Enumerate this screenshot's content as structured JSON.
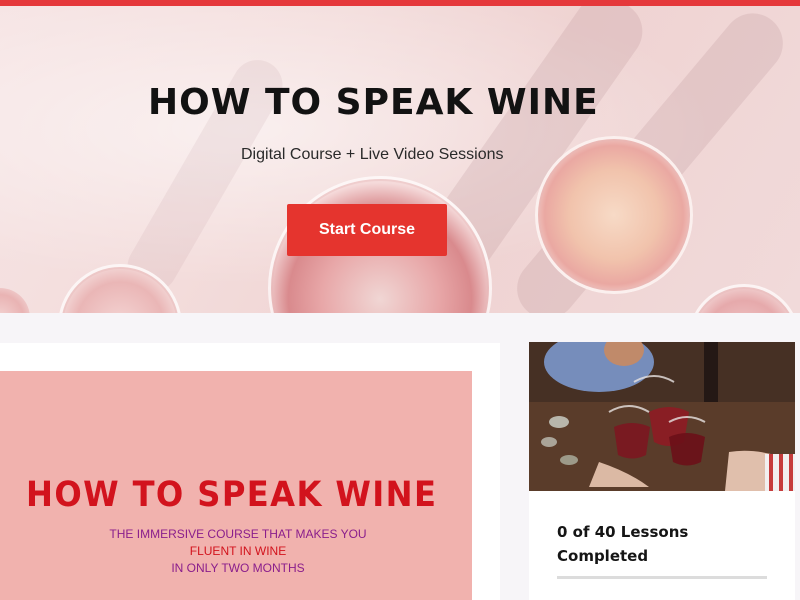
{
  "hero": {
    "title": "HOW TO SPEAK WINE",
    "subtitle": "Digital Course + Live Video Sessions",
    "cta_label": "Start Course"
  },
  "promo": {
    "title": "HOW TO SPEAK WINE",
    "tagline_line1": "THE IMMERSIVE COURSE THAT MAKES YOU",
    "tagline_line2": "FLUENT IN WINE",
    "tagline_line3": "IN ONLY TWO MONTHS"
  },
  "course_card": {
    "progress_line1": "0 of 40 Lessons",
    "progress_line2": "Completed",
    "lessons_completed": 0,
    "lessons_total": 40
  },
  "colors": {
    "accent": "#e5342e",
    "promo_background": "#f1b2ae",
    "promo_title": "#d2131d",
    "promo_tagline": "#8a1e8c"
  }
}
